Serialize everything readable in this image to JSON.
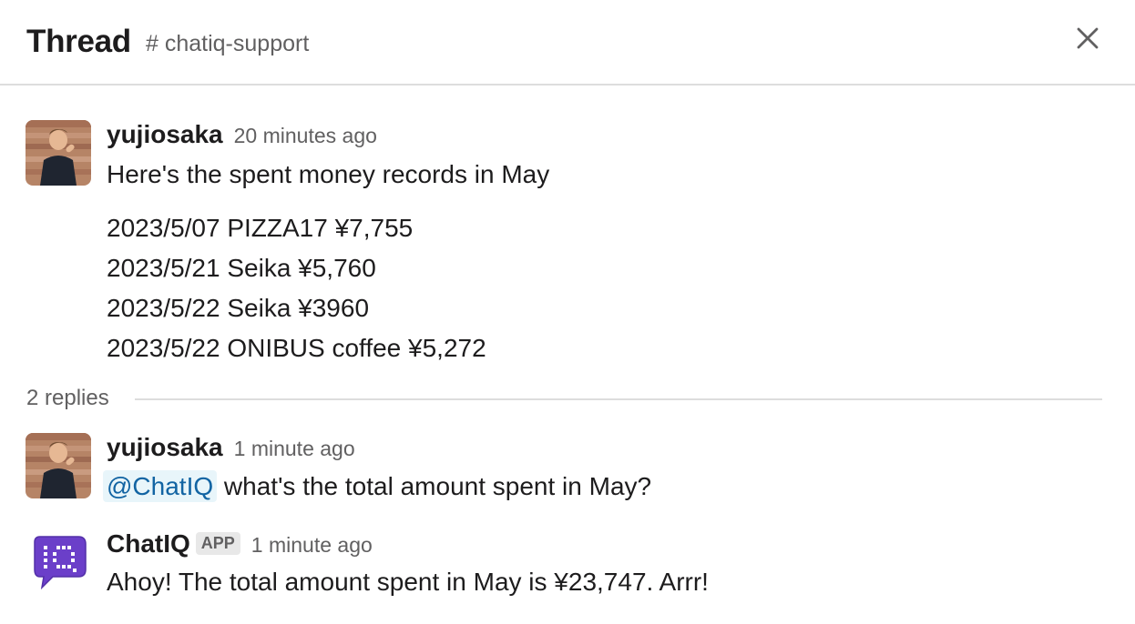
{
  "header": {
    "title": "Thread",
    "channel": "# chatiq-support",
    "close_icon": "close-icon"
  },
  "messages": [
    {
      "author": "yujiosaka",
      "time": "20 minutes ago",
      "text": "Here's the spent money records in May",
      "records": [
        "2023/5/07 PIZZA17 ¥7,755",
        "2023/5/21 Seika ¥5,760",
        "2023/5/22 Seika ¥3960",
        "2023/5/22 ONIBUS coffee ¥5,272"
      ]
    }
  ],
  "thread": {
    "replies_label": "2 replies"
  },
  "replies": [
    {
      "author": "yujiosaka",
      "time": "1 minute ago",
      "mention": "@ChatIQ",
      "text": "what's the total amount spent in May?"
    },
    {
      "author": "ChatIQ",
      "badge": "APP",
      "time": "1 minute ago",
      "text": "Ahoy! The total amount spent in May is ¥23,747. Arrr!"
    }
  ],
  "colors": {
    "accent_purple": "#6b3fc9",
    "mention_blue": "#1264a3",
    "mention_bg": "#e8f5fa"
  }
}
